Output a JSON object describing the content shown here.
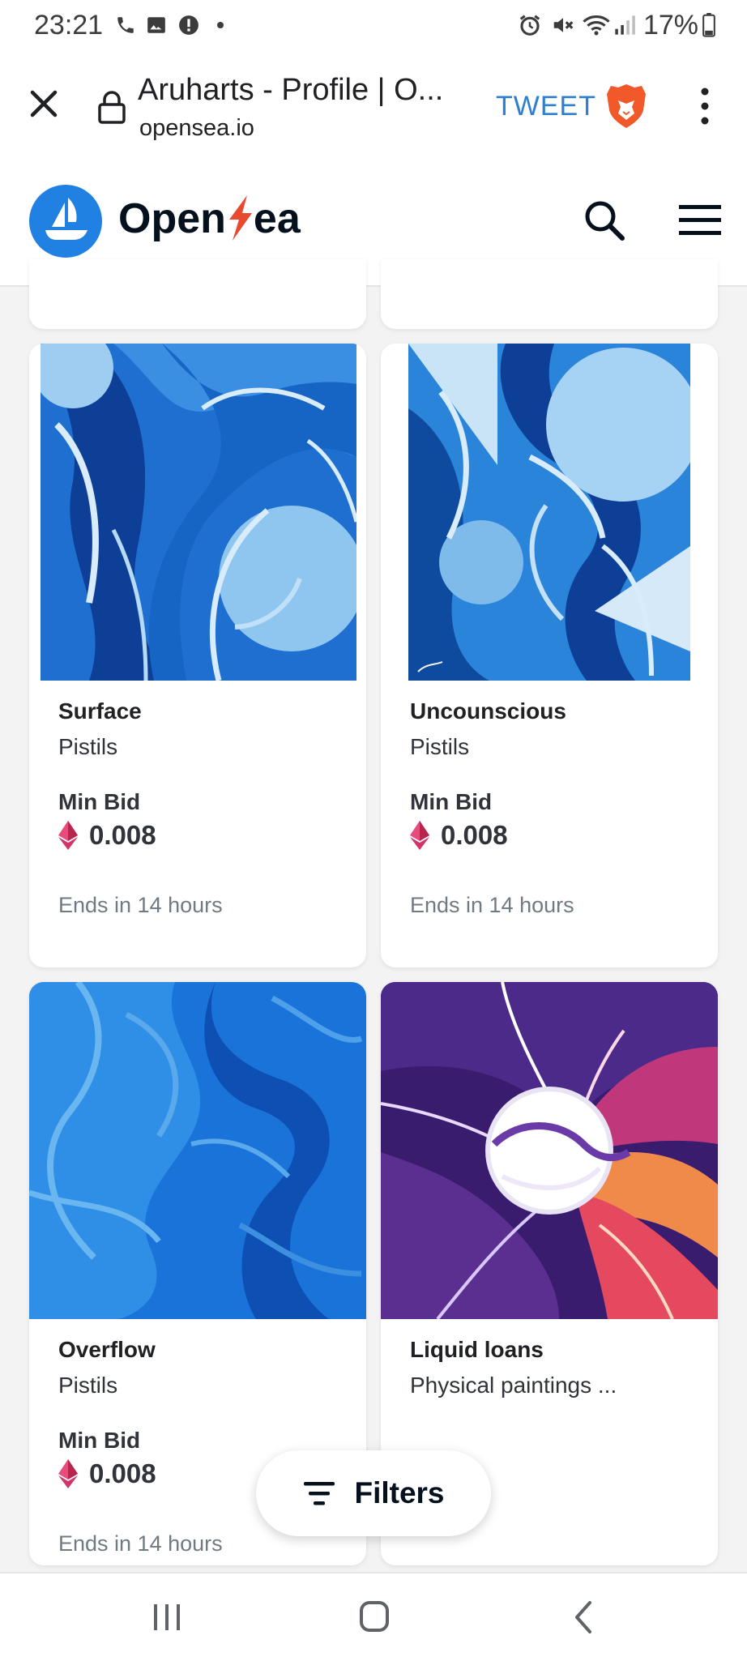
{
  "status_bar": {
    "time": "23:21",
    "battery": "17%",
    "left_icons": [
      "phone-icon",
      "image-icon",
      "alert-icon",
      "dot-icon"
    ],
    "right_icons": [
      "alarm-icon",
      "mute-icon",
      "wifi-icon",
      "signal-icon",
      "battery-icon"
    ]
  },
  "browser": {
    "title": "Aruharts - Profile | O...",
    "url": "opensea.io",
    "tweet_label": "TWEET",
    "close_icon": "close-icon",
    "lock_icon": "lock-icon",
    "brave_icon": "brave-lion-icon",
    "menu_icon": "more-vert-icon"
  },
  "header": {
    "brand_part1": "Open",
    "brand_part2": "ea",
    "logo_icon": "opensea-boat-icon",
    "search_icon": "search-icon",
    "menu_icon": "hamburger-icon"
  },
  "cards": [
    {
      "name": "Surface",
      "collection": "Pistils",
      "bid_label": "Min Bid",
      "price": "0.008",
      "ends": "Ends in 14 hours"
    },
    {
      "name": "Uncounscious",
      "collection": "Pistils",
      "bid_label": "Min Bid",
      "price": "0.008",
      "ends": "Ends in 14 hours"
    },
    {
      "name": "Overflow",
      "collection": "Pistils",
      "bid_label": "Min Bid",
      "price": "0.008",
      "ends": "Ends in 14 hours"
    },
    {
      "name": "Liquid loans",
      "collection": "Physical paintings ..."
    }
  ],
  "filters": {
    "label": "Filters",
    "icon": "filter-icon"
  },
  "nav": {
    "icons": [
      "recent-apps-icon",
      "home-icon",
      "back-icon"
    ]
  },
  "colors": {
    "opensea_blue": "#2081e2",
    "tweet_blue": "#2f7fd0",
    "eth_pink": "#d1356b"
  }
}
